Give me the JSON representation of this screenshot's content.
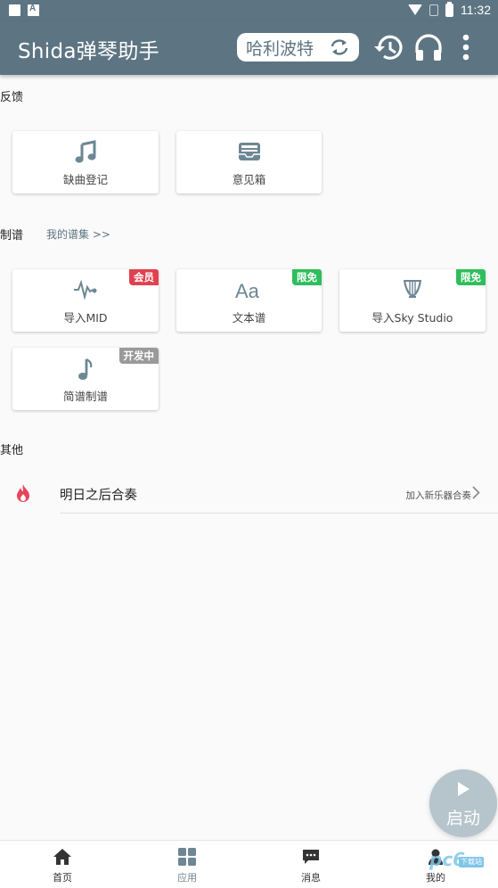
{
  "statusbar": {
    "time": "11:32"
  },
  "appbar": {
    "title": "Shida弹琴助手",
    "current_song": "哈利波特",
    "icons": [
      "refresh-icon",
      "history-icon",
      "headphones-icon",
      "more-vert-icon"
    ]
  },
  "feedback": {
    "label": "反馈",
    "cards": [
      {
        "label": "缺曲登记",
        "icon": "music-note-icon"
      },
      {
        "label": "意见箱",
        "icon": "inbox-icon"
      }
    ]
  },
  "scoring": {
    "label": "制谱",
    "link": "我的谱集 >>",
    "cards": [
      {
        "label": "导入MID",
        "icon": "waveform-icon",
        "badge": "会员"
      },
      {
        "label": "文本谱",
        "icon": "text-aa-icon",
        "badge": "限免"
      },
      {
        "label": "导入Sky Studio",
        "icon": "lyre-icon",
        "badge": "限免"
      },
      {
        "label": "简谱制谱",
        "icon": "single-note-icon",
        "badge": "开发中"
      }
    ]
  },
  "other": {
    "label": "其他",
    "row": {
      "title": "明日之后合奏",
      "hint": "加入新乐器合奏",
      "icon": "flame-icon"
    }
  },
  "fab": {
    "label": "启动"
  },
  "bottom_nav": {
    "items": [
      {
        "label": "首页",
        "icon": "home-icon"
      },
      {
        "label": "应用",
        "icon": "apps-grid-icon"
      },
      {
        "label": "消息",
        "icon": "message-icon"
      },
      {
        "label": "我的",
        "icon": "person-icon"
      }
    ],
    "active": "应用"
  },
  "watermark": {
    "text": "pc6",
    "badge": "下载站"
  },
  "colors": {
    "primary": "#5d7582",
    "badge_red": "#e0424f",
    "badge_green": "#2fbe5c",
    "badge_gray": "#9a9a9a",
    "flame": "#e8445a"
  }
}
